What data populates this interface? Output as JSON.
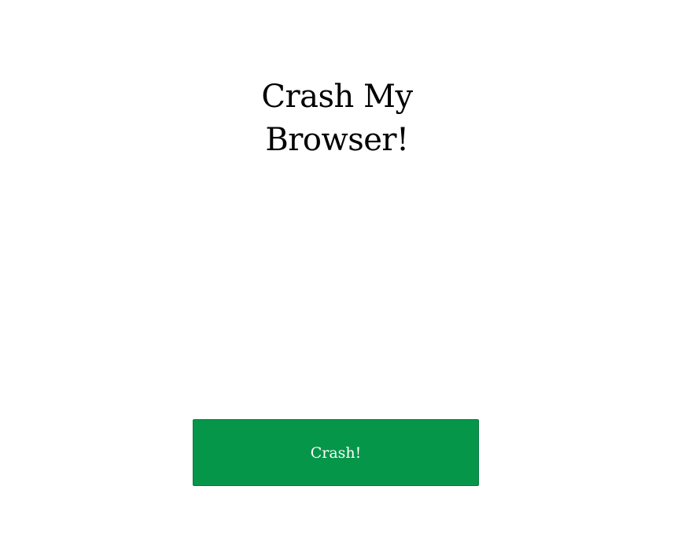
{
  "page": {
    "title_line1": "Crash My",
    "title_line2": "Browser!"
  },
  "button": {
    "label": "Crash!"
  },
  "colors": {
    "button_bg": "#06964a",
    "text": "#000000",
    "background": "#ffffff"
  }
}
